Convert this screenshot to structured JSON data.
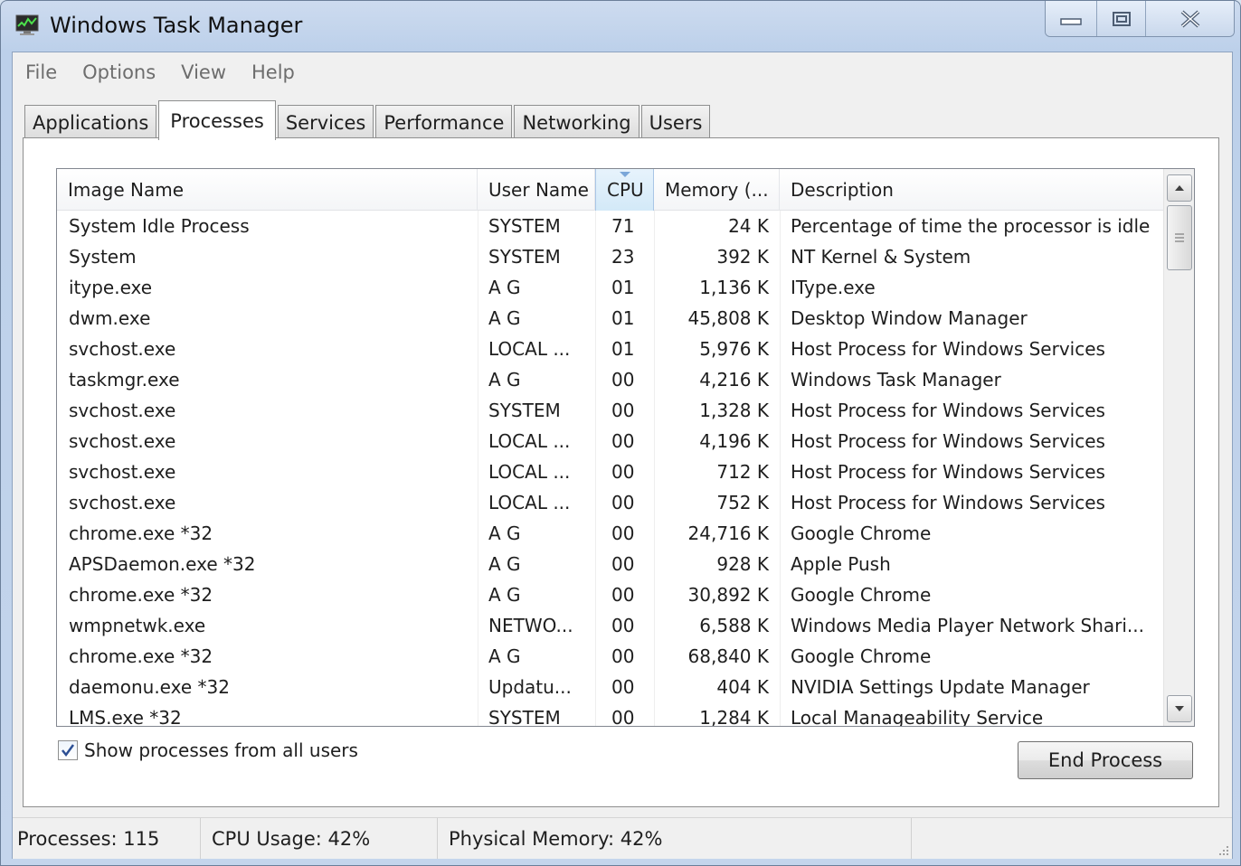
{
  "window": {
    "title": "Windows Task Manager"
  },
  "menu": [
    "File",
    "Options",
    "View",
    "Help"
  ],
  "tabs": [
    "Applications",
    "Processes",
    "Services",
    "Performance",
    "Networking",
    "Users"
  ],
  "active_tab": "Processes",
  "columns": [
    "Image Name",
    "User Name",
    "CPU",
    "Memory (...",
    "Description"
  ],
  "sorted_column": "CPU",
  "processes": [
    [
      "System Idle Process",
      "SYSTEM",
      "71",
      "24 K",
      "Percentage of time the processor is idle"
    ],
    [
      "System",
      "SYSTEM",
      "23",
      "392 K",
      "NT Kernel & System"
    ],
    [
      "itype.exe",
      "A G",
      "01",
      "1,136 K",
      "IType.exe"
    ],
    [
      "dwm.exe",
      "A G",
      "01",
      "45,808 K",
      "Desktop Window Manager"
    ],
    [
      "svchost.exe",
      "LOCAL ...",
      "01",
      "5,976 K",
      "Host Process for Windows Services"
    ],
    [
      "taskmgr.exe",
      "A G",
      "00",
      "4,216 K",
      "Windows Task Manager"
    ],
    [
      "svchost.exe",
      "SYSTEM",
      "00",
      "1,328 K",
      "Host Process for Windows Services"
    ],
    [
      "svchost.exe",
      "LOCAL ...",
      "00",
      "4,196 K",
      "Host Process for Windows Services"
    ],
    [
      "svchost.exe",
      "LOCAL ...",
      "00",
      "712 K",
      "Host Process for Windows Services"
    ],
    [
      "svchost.exe",
      "LOCAL ...",
      "00",
      "752 K",
      "Host Process for Windows Services"
    ],
    [
      "chrome.exe *32",
      "A G",
      "00",
      "24,716 K",
      "Google Chrome"
    ],
    [
      "APSDaemon.exe *32",
      "A G",
      "00",
      "928 K",
      "Apple Push"
    ],
    [
      "chrome.exe *32",
      "A G",
      "00",
      "30,892 K",
      "Google Chrome"
    ],
    [
      "wmpnetwk.exe",
      "NETWO...",
      "00",
      "6,588 K",
      "Windows Media Player Network Shari..."
    ],
    [
      "chrome.exe *32",
      "A G",
      "00",
      "68,840 K",
      "Google Chrome"
    ],
    [
      "daemonu.exe *32",
      "Updatu...",
      "00",
      "404 K",
      "NVIDIA Settings Update Manager"
    ],
    [
      "LMS.exe *32",
      "SYSTEM",
      "00",
      "1,284 K",
      "Local Manageability Service"
    ]
  ],
  "show_all_label": "Show processes from all users",
  "show_all_checked": true,
  "end_process_label": "End Process",
  "status": {
    "processes": "Processes: 115",
    "cpu": "CPU Usage: 42%",
    "memory": "Physical Memory: 42%"
  },
  "icons": {
    "app": "task-manager-icon",
    "minimize": "minimize-icon",
    "maximize": "maximize-icon",
    "close": "close-icon"
  }
}
